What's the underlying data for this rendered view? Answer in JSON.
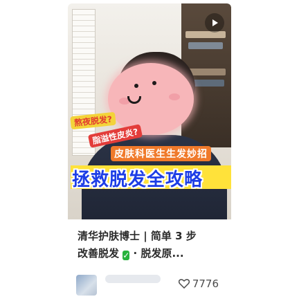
{
  "cover": {
    "tag_yellow": "熬夜脱发?",
    "tag_red": "脂溢性皮炎?",
    "tag_orange": "皮肤科医生生发妙招",
    "headline": "拯救脱发全攻略"
  },
  "title": {
    "line1": "清华护肤博士 | 简单 3 步",
    "line2_prefix": "改善脱发",
    "line2_suffix": "· 脱发原..."
  },
  "footer": {
    "like_count": "7776"
  },
  "icons": {
    "play": "play-icon",
    "check": "check-icon",
    "like": "heart-outline-icon"
  },
  "colors": {
    "headline_text": "#1d3ee6",
    "headline_bg": "#ffe23a",
    "tag_red": "#e33d3a",
    "tag_orange": "#f07a2b",
    "check_green": "#27b23d"
  }
}
